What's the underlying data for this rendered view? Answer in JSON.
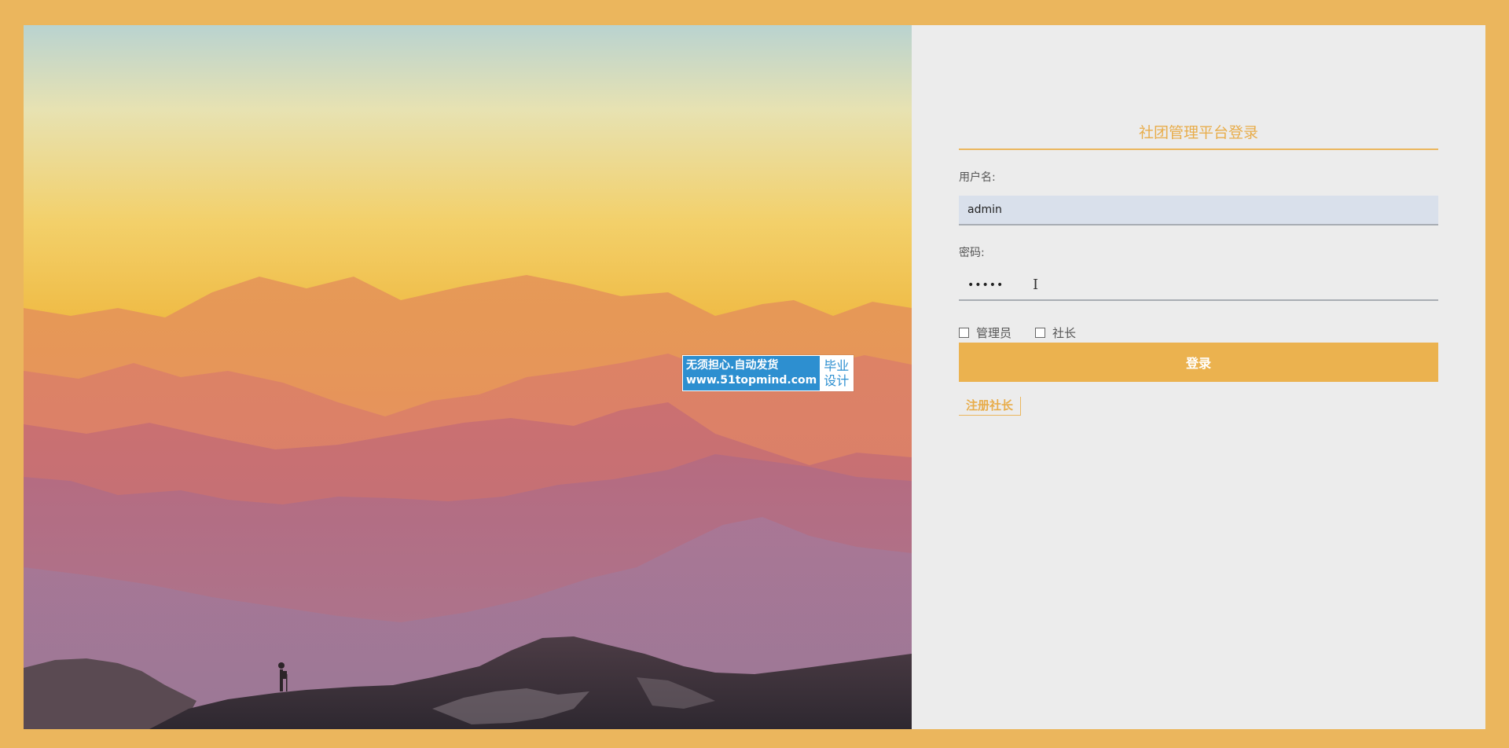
{
  "watermark": {
    "line1": "无须担心.自动发货",
    "line2": "www.51topmind.com",
    "side1": "毕业",
    "side2": "设计"
  },
  "login": {
    "title": "社团管理平台登录",
    "username_label": "用户名:",
    "username_value": "admin",
    "password_label": "密码:",
    "password_value": "•••••",
    "role_admin": "管理员",
    "role_president": "社长",
    "login_button": "登录",
    "register_link": "注册社长"
  },
  "colors": {
    "accent": "#ebb65d",
    "input_fill": "#d9e0eb",
    "watermark_blue": "#2d8fd0"
  }
}
